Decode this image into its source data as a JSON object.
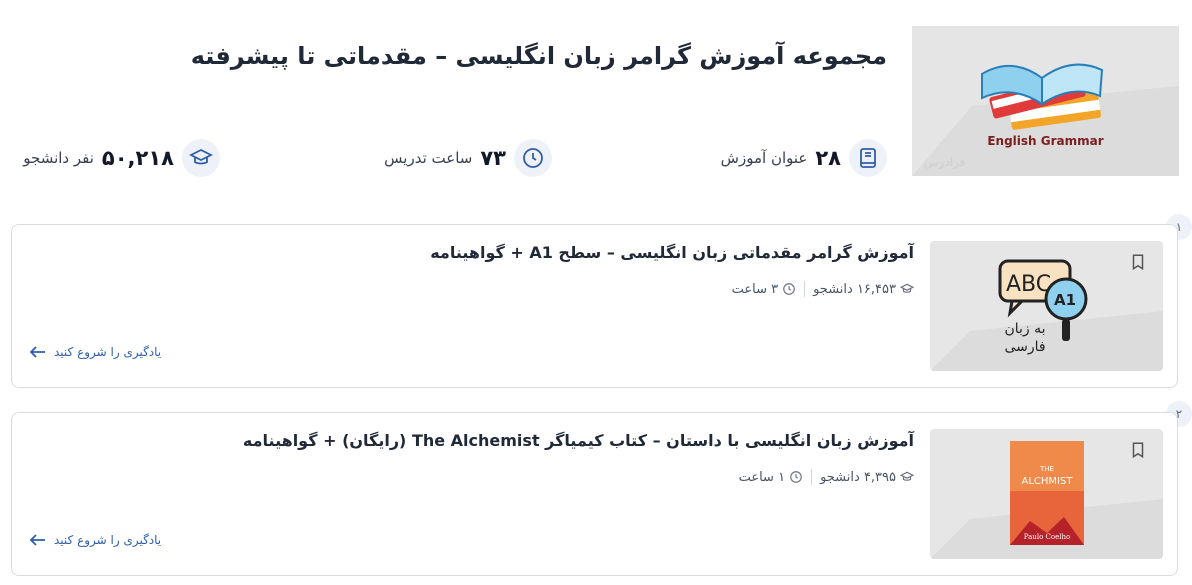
{
  "header": {
    "title": "مجموعه آموزش گرامر زبان انگلیسی – مقدماتی تا پیشرفته",
    "thumbnail_caption": "English Grammar",
    "watermark": "فرادرس",
    "stats": {
      "lessons": {
        "value": "۲۸",
        "label": "عنوان آموزش",
        "icon": "book-icon"
      },
      "hours": {
        "value": "۷۳",
        "label": "ساعت تدریس",
        "icon": "clock-icon"
      },
      "students": {
        "value": "۵۰,۲۱۸",
        "label": "نفر دانشجو",
        "icon": "graduation-cap-icon"
      }
    }
  },
  "courses": [
    {
      "index": "۱",
      "title": "آموزش گرامر مقدماتی زبان انگلیسی – سطح A1 + گواهینامه",
      "students": "۱۶,۴۵۳ دانشجو",
      "duration": "۳ ساعت",
      "cta": "یادگیری را شروع کنید",
      "thumb": {
        "letters": "ABC",
        "level": "A1",
        "caption_line1": "به زبان",
        "caption_line2": "فارسی"
      }
    },
    {
      "index": "۲",
      "title": "آموزش زبان انگلیسی با داستان – کتاب کیمیاگر The Alchemist (رایگان) + گواهینامه",
      "students": "۴,۳۹۵ دانشجو",
      "duration": "۱ ساعت",
      "cta": "یادگیری را شروع کنید",
      "thumb": {
        "book_top": "THE",
        "book_title": "ALCHMIST",
        "book_author": "Paulo Coelho"
      }
    }
  ],
  "colors": {
    "accent": "#2f5fa8",
    "border": "#d9dde3",
    "icon_bg": "#eef2f8"
  }
}
